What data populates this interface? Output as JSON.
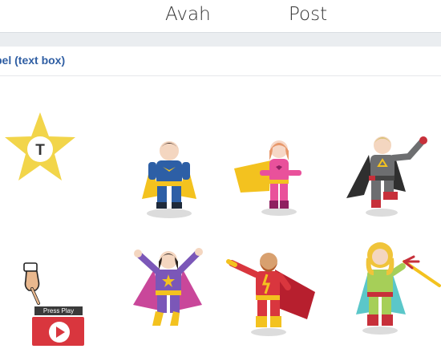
{
  "header": {
    "label_left": "Avah",
    "label_right": "Post"
  },
  "section": {
    "label": "bel (text box)"
  },
  "star_button": {
    "letter": "T",
    "icon": "star-text-icon",
    "color": "#f2d54a"
  },
  "play_button": {
    "label": "Press Play",
    "icon": "pointing-hand-icon",
    "color": "#d9363e"
  },
  "superheroes": [
    {
      "icon": "superhero-man-blue-icon"
    },
    {
      "icon": "superhero-woman-pink-icon"
    },
    {
      "icon": "supervillain-man-gray-icon"
    },
    {
      "icon": "superhero-woman-purple-icon"
    },
    {
      "icon": "superhero-man-red-icon"
    },
    {
      "icon": "supervillain-woman-green-icon"
    }
  ]
}
